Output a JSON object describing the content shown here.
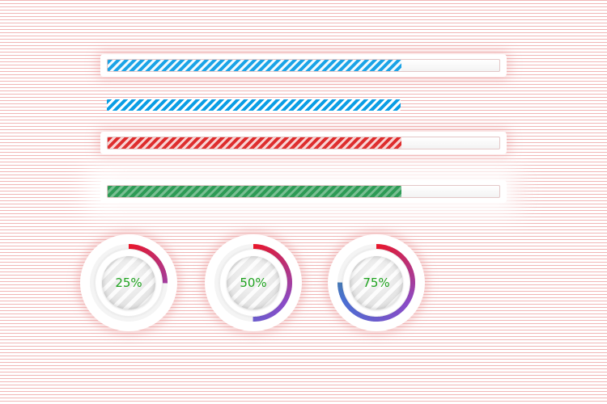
{
  "linear_bars": [
    {
      "name": "blue-framed",
      "progress": 0.75,
      "color": "#1aa3e6"
    },
    {
      "name": "blue-bare",
      "progress": 0.75,
      "color": "#0a9de4"
    },
    {
      "name": "red-framed",
      "progress": 0.75,
      "color": "#de2a2a"
    },
    {
      "name": "green-glow",
      "progress": 0.75,
      "color": "#2e9b56"
    }
  ],
  "circular": [
    {
      "label": "25%",
      "progress": 0.25
    },
    {
      "label": "50%",
      "progress": 0.5
    },
    {
      "label": "75%",
      "progress": 0.75
    }
  ],
  "ring_gradient": [
    "#e8172c",
    "#8b4bc7",
    "#4a6fd3",
    "#3b9d4f"
  ],
  "text_color": "#1fa31f"
}
